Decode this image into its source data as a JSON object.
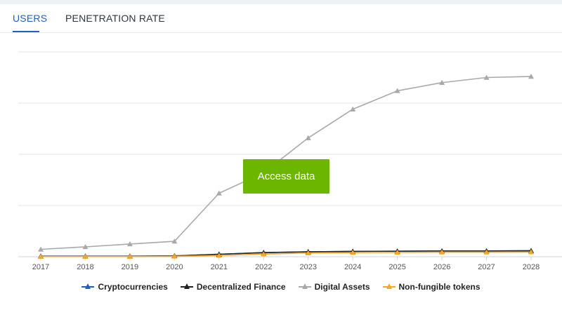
{
  "tabs": [
    {
      "label": "USERS"
    },
    {
      "label": "PENETRATION RATE"
    }
  ],
  "overlay": {
    "access_label": "Access data"
  },
  "colors": {
    "tab_active": "#1f5fbf",
    "access_button": "#6cb600",
    "gridline": "#e3e6ea"
  },
  "chart_data": {
    "type": "line",
    "x": [
      "2017",
      "2018",
      "2019",
      "2020",
      "2021",
      "2022",
      "2023",
      "2024",
      "2025",
      "2026",
      "2027",
      "2028"
    ],
    "ylim": [
      0,
      1.0
    ],
    "grid": true,
    "legend_placement": "bottom",
    "series": [
      {
        "name": "Cryptocurrencies",
        "color": "#1f5fbf",
        "values": [
          0.003,
          0.003,
          0.003,
          0.004,
          0.012,
          0.02,
          0.024,
          0.026,
          0.027,
          0.028,
          0.028,
          0.029
        ]
      },
      {
        "name": "Decentralized Finance",
        "color": "#222222",
        "values": [
          0.002,
          0.002,
          0.002,
          0.004,
          0.012,
          0.02,
          0.024,
          0.026,
          0.027,
          0.028,
          0.028,
          0.029
        ]
      },
      {
        "name": "Digital Assets",
        "color": "#a8a8ad",
        "values": [
          0.036,
          0.048,
          0.062,
          0.075,
          0.31,
          0.41,
          0.58,
          0.72,
          0.81,
          0.85,
          0.875,
          0.88
        ]
      },
      {
        "name": "Non-fungible tokens",
        "color": "#f5a623",
        "values": [
          0.001,
          0.001,
          0.001,
          0.002,
          0.006,
          0.013,
          0.018,
          0.02,
          0.021,
          0.022,
          0.022,
          0.023
        ]
      }
    ]
  }
}
